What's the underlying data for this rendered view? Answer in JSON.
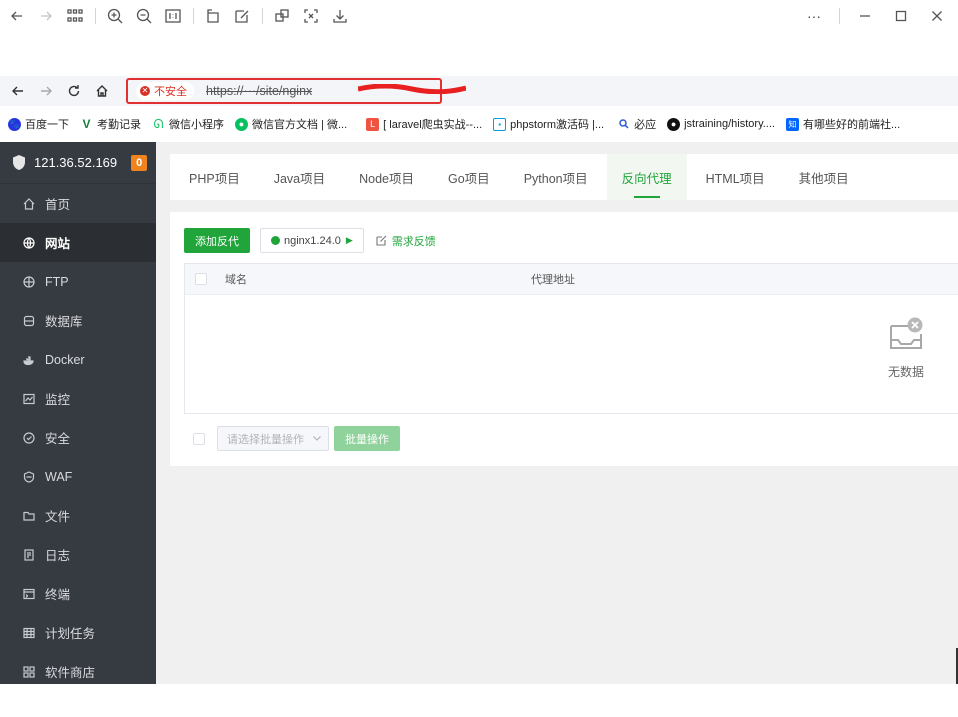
{
  "viewer": {
    "more_label": "···"
  },
  "browser": {
    "insecure_label": "不安全",
    "url": "https://···/site/nginx"
  },
  "bookmarks": [
    {
      "label": "百度一下",
      "icon": "baidu-icon",
      "color": "#2932e1"
    },
    {
      "label": "考勤记录",
      "icon": "v-logo-icon",
      "color": "#1a7f3c"
    },
    {
      "label": "微信小程序",
      "icon": "mini-program-icon",
      "color": "#07c160"
    },
    {
      "label": "微信官方文档 | 微...",
      "icon": "wechat-icon",
      "color": "#07c160"
    },
    {
      "label": "[ laravel爬虫实战--...",
      "icon": "laravel-icon",
      "color": "#f05340"
    },
    {
      "label": "phpstorm激活码 |...",
      "icon": "bilibili-icon",
      "color": "#00a1d6"
    },
    {
      "label": "必应",
      "icon": "search-icon",
      "color": "#2a5bd7"
    },
    {
      "label": "jstraining/history....",
      "icon": "github-icon",
      "color": "#111111"
    },
    {
      "label": "有哪些好的前端社...",
      "icon": "zhihu-icon",
      "color": "#0066ff"
    }
  ],
  "sidebar": {
    "server_ip": "121.36.52.169",
    "badge_count": "0",
    "items": [
      {
        "label": "首页",
        "icon": "home-icon"
      },
      {
        "label": "网站",
        "icon": "globe-icon",
        "active": true
      },
      {
        "label": "FTP",
        "icon": "ftp-icon"
      },
      {
        "label": "数据库",
        "icon": "database-icon"
      },
      {
        "label": "Docker",
        "icon": "docker-icon"
      },
      {
        "label": "监控",
        "icon": "monitor-icon"
      },
      {
        "label": "安全",
        "icon": "shield-icon"
      },
      {
        "label": "WAF",
        "icon": "waf-icon"
      },
      {
        "label": "文件",
        "icon": "folder-icon"
      },
      {
        "label": "日志",
        "icon": "log-icon"
      },
      {
        "label": "终端",
        "icon": "terminal-icon"
      },
      {
        "label": "计划任务",
        "icon": "calendar-icon"
      },
      {
        "label": "软件商店",
        "icon": "apps-icon"
      }
    ]
  },
  "tabs": [
    {
      "label": "PHP项目"
    },
    {
      "label": "Java项目"
    },
    {
      "label": "Node项目"
    },
    {
      "label": "Go项目"
    },
    {
      "label": "Python项目"
    },
    {
      "label": "反向代理",
      "active": true
    },
    {
      "label": "HTML项目"
    },
    {
      "label": "其他项目"
    }
  ],
  "toolbar": {
    "add_proxy_label": "添加反代",
    "nginx_label": "nginx1.24.0",
    "feedback_label": "需求反馈"
  },
  "table": {
    "columns": [
      "域名",
      "代理地址"
    ],
    "empty_text": "无数据"
  },
  "batch": {
    "select_placeholder": "请选择批量操作",
    "button_label": "批量操作"
  },
  "colors": {
    "accent": "#20a53a",
    "sidebar_bg": "#363a41",
    "badge": "#f0831e",
    "insecure": "#d93025",
    "highlight_border": "#e0302f"
  }
}
